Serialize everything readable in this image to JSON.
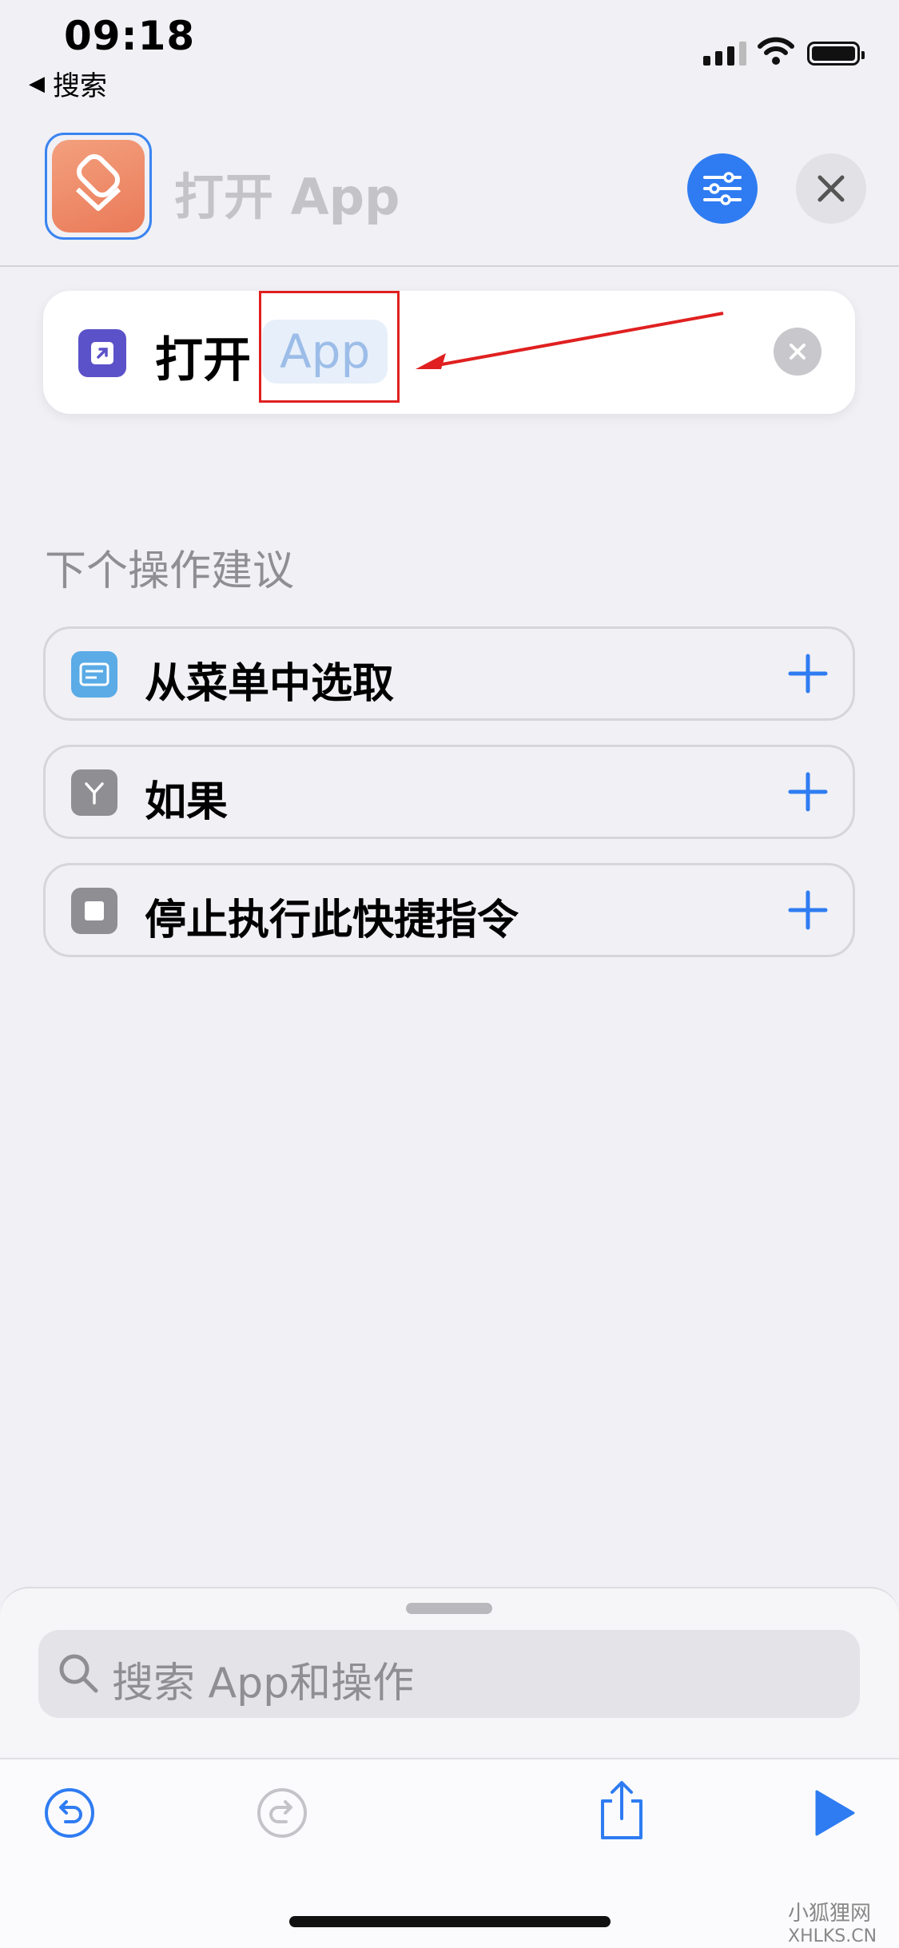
{
  "status": {
    "time": "09:18",
    "back_label": "搜索"
  },
  "header": {
    "title": "打开 App"
  },
  "action": {
    "verb": "打开",
    "param": "App"
  },
  "suggestions": {
    "heading": "下个操作建议",
    "items": [
      {
        "label": "从菜单中选取",
        "icon": "menu-list-icon",
        "color": "#5aabe6"
      },
      {
        "label": "如果",
        "icon": "branch-icon",
        "color": "#8e8e93"
      },
      {
        "label": "停止执行此快捷指令",
        "icon": "stop-icon",
        "color": "#8e8e93"
      }
    ]
  },
  "search": {
    "placeholder": "搜索 App和操作"
  },
  "watermark": {
    "cn": "小狐狸网",
    "en": "XHLKS.CN"
  },
  "colors": {
    "accent": "#2f7cf2",
    "app_icon": "#ee8a66",
    "annotation": "#e02020"
  }
}
